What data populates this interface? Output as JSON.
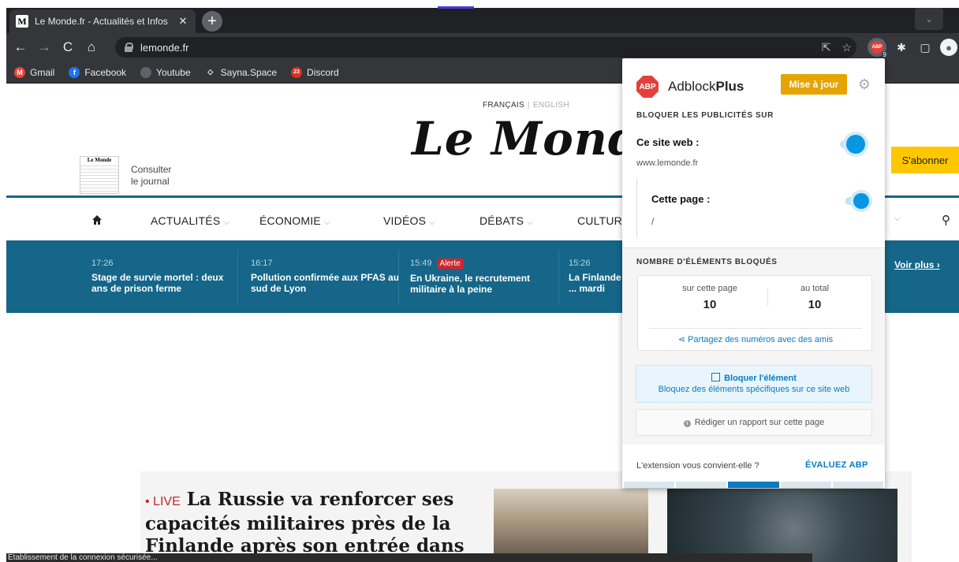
{
  "browser": {
    "tab_title": "Le Monde.fr - Actualités et Infos",
    "favicon_letter": "M",
    "url": "lemonde.fr",
    "bookmarks": [
      {
        "label": "Gmail",
        "icon": "M",
        "color": "#ea4335"
      },
      {
        "label": "Facebook",
        "icon": "f",
        "color": "#1877f2"
      },
      {
        "label": "Youtube",
        "icon": "",
        "color": "#5f6368"
      },
      {
        "label": "Sayna.Space",
        "icon": "◇",
        "color": "#35363a"
      },
      {
        "label": "Discord",
        "icon": "23",
        "color": "#d93025"
      }
    ],
    "ext_badge_count": "9",
    "status_text": "Établissement de la connexion sécurisée..."
  },
  "site": {
    "lang_fr": "FRANÇAIS",
    "lang_en": "ENGLISH",
    "logo": "Le Monde",
    "journal_thumb_head": "Le Monde",
    "consulter_line1": "Consulter",
    "consulter_line2": "le journal",
    "subscribe": "S'abonner",
    "nav": {
      "actualites": "ACTUALITÉS",
      "economie": "ÉCONOMIE",
      "videos": "VIDÉOS",
      "debats": "DÉBATS",
      "culture": "CULTURE"
    },
    "breaking": [
      {
        "time": "17:26",
        "title": "Stage de survie mortel : deux ans de prison ferme",
        "alert": ""
      },
      {
        "time": "16:17",
        "title": "Pollution confirmée aux PFAS au sud de Lyon",
        "alert": ""
      },
      {
        "time": "15:49",
        "title": "En Ukraine, le recrutement militaire à la peine",
        "alert": "Alerte"
      },
      {
        "time": "15:26",
        "title": "La Finlande ... mardi",
        "alert": ""
      }
    ],
    "voir_plus": "Voir plus",
    "lead_live": "• LIVE",
    "lead_title": "La Russie va renforcer ses capacités militaires près de la Finlande après son entrée dans"
  },
  "abp": {
    "logo_text": "ABP",
    "brand_normal": "Adblock",
    "brand_bold": "Plus",
    "update_button": "Mise à jour",
    "section_block_title": "BLOQUER LES PUBLICITÉS SUR",
    "site_label": "Ce site web :",
    "site_url": "www.lemonde.fr",
    "page_label": "Cette page :",
    "page_path": "/",
    "section_count_title": "NOMBRE D'ÉLÉMENTS BLOQUÉS",
    "stat_page_label": "sur cette page",
    "stat_page_value": "10",
    "stat_total_label": "au total",
    "stat_total_value": "10",
    "share_text": "Partagez des numéros avec des amis",
    "block_element_title": "Bloquer l'élément",
    "block_element_desc": "Bloquez des éléments spécifiques sur ce site web",
    "report_text": "Rédiger un rapport sur cette page",
    "footer_question": "L'extension vous convient-elle ?",
    "footer_rate": "ÉVALUEZ ABP",
    "colors": {
      "accent": "#0797e1",
      "update": "#e7a400",
      "brand_red": "#e2403c"
    }
  }
}
